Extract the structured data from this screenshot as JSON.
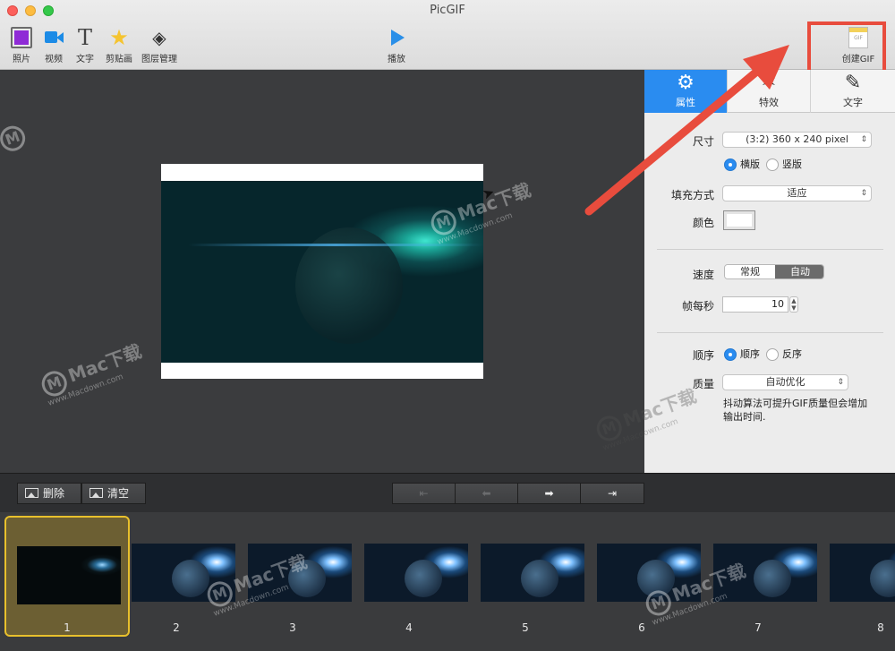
{
  "window": {
    "title": "PicGIF"
  },
  "toolbar": {
    "items": [
      {
        "label": "照片",
        "icon": "photo-icon"
      },
      {
        "label": "视频",
        "icon": "video-icon"
      },
      {
        "label": "文字",
        "icon": "text-icon"
      },
      {
        "label": "剪贴画",
        "icon": "clipart-star-icon"
      },
      {
        "label": "图层管理",
        "icon": "layers-icon"
      }
    ],
    "play_label": "播放",
    "create_gif_label": "创建GIF",
    "create_gif_icon_text": "GIF"
  },
  "panel": {
    "tabs": [
      {
        "label": "属性",
        "icon": "gear-icon"
      },
      {
        "label": "特效",
        "icon": "magic-wand-icon"
      },
      {
        "label": "文字",
        "icon": "edit-text-icon"
      }
    ],
    "size_label": "尺寸",
    "size_value": "(3:2) 360 x 240 pixel",
    "orientation_landscape": "横版",
    "orientation_portrait": "竖版",
    "fill_label": "填充方式",
    "fill_value": "适应",
    "color_label": "颜色",
    "speed_label": "速度",
    "speed_normal": "常规",
    "speed_auto": "自动",
    "fps_label": "帧每秒",
    "fps_value": "10",
    "order_label": "顺序",
    "order_forward": "顺序",
    "order_reverse": "反序",
    "quality_label": "质量",
    "quality_value": "自动优化",
    "hint": "抖动算法可提升GIF质量但会增加输出时间."
  },
  "bottom": {
    "delete_label": "删除",
    "clear_label": "清空",
    "nav": [
      "⇤",
      "⬅",
      "➡",
      "⇥"
    ]
  },
  "frames": [
    "1",
    "2",
    "3",
    "4",
    "5",
    "6",
    "7",
    "8"
  ],
  "watermark": {
    "brand": "Mac下载",
    "url": "www.Macdown.com",
    "logo": "M"
  },
  "colors": {
    "accent": "#2a8cf0",
    "arrow": "#e84c3d",
    "selected_frame": "#e8c02c"
  }
}
